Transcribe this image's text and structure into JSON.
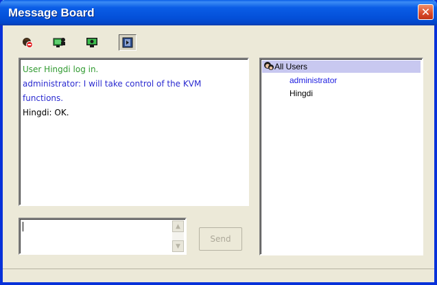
{
  "window": {
    "title": "Message Board",
    "close_glyph": "✕"
  },
  "toolbar": {
    "buttons": [
      {
        "icon": "user-block-icon",
        "pressed": false
      },
      {
        "icon": "computer-user-icon",
        "pressed": false
      },
      {
        "icon": "computer-screen-icon",
        "pressed": false
      },
      {
        "icon": "panel-toggle-icon",
        "pressed": true
      }
    ]
  },
  "chat": {
    "messages": [
      {
        "text": "User Hingdi log in.",
        "color": "#2f9a2f"
      },
      {
        "text": "administrator: I will take control of the KVM",
        "color": "#2a2ad0"
      },
      {
        "text": "functions.",
        "color": "#2a2ad0"
      },
      {
        "text": "Hingdi: OK.",
        "color": "#000000"
      }
    ]
  },
  "compose": {
    "value": "",
    "send_label": "Send"
  },
  "users": {
    "header": "All Users",
    "list": [
      {
        "name": "administrator",
        "color": "#1a1ae0"
      },
      {
        "name": "Hingdi",
        "color": "#000000"
      }
    ]
  },
  "colors": {
    "titlebar": "#0450d9",
    "window_bg": "#ece9d8",
    "users_header_bg": "#c8c8f0"
  }
}
